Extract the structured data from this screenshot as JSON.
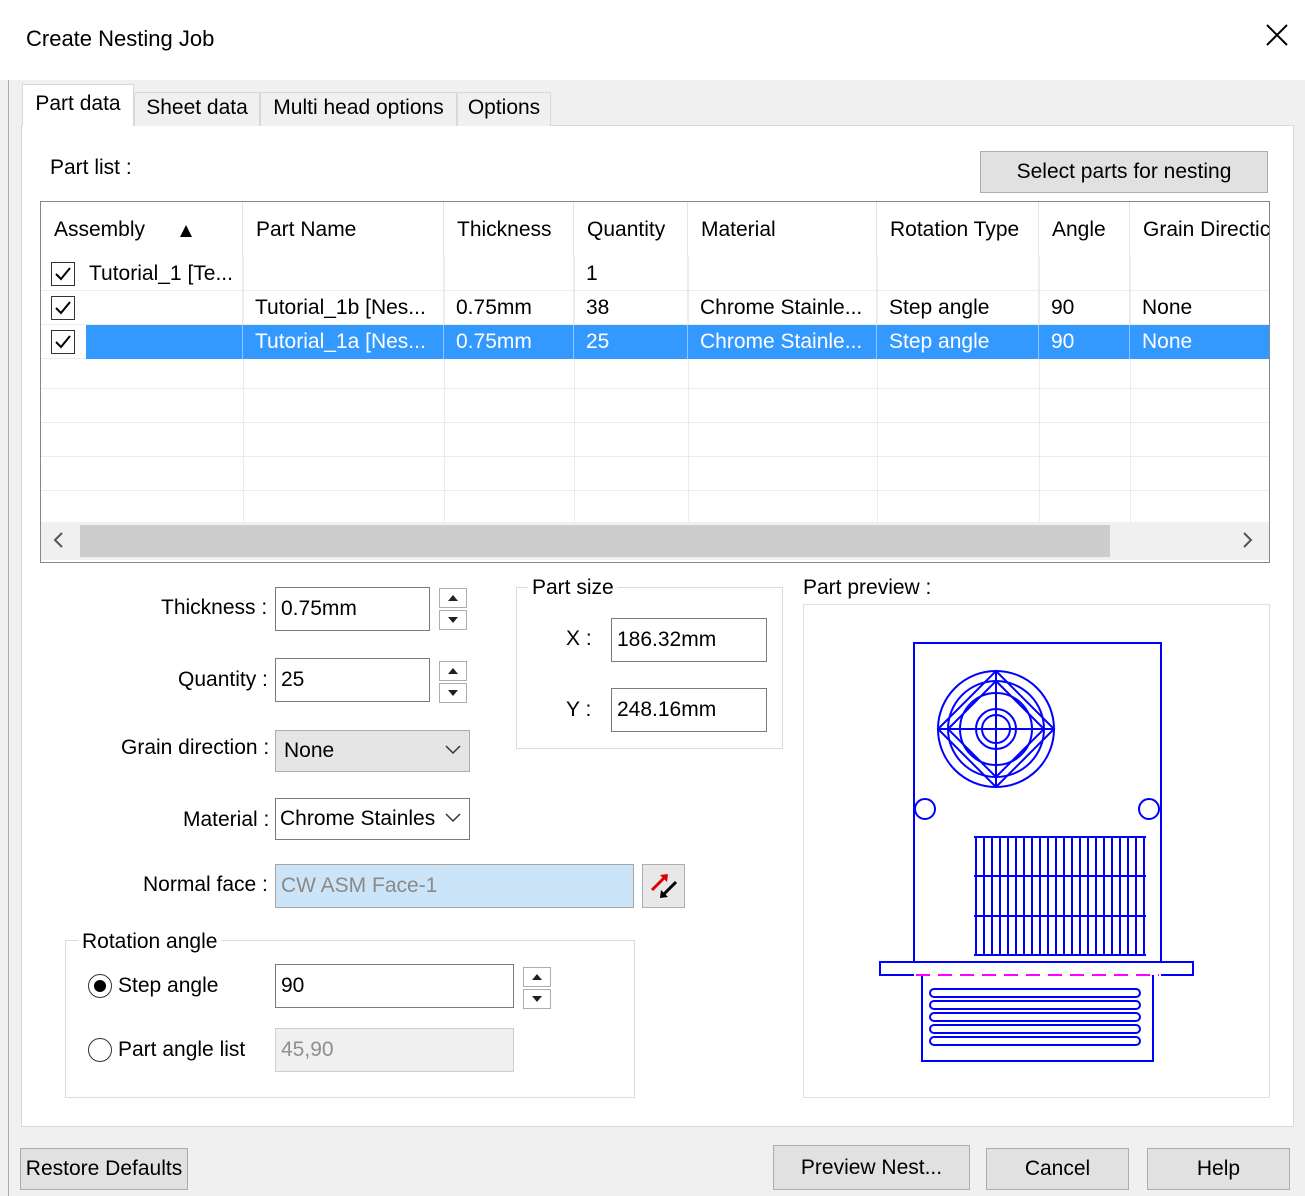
{
  "window": {
    "title": "Create Nesting Job"
  },
  "tabs": [
    "Part data",
    "Sheet data",
    "Multi head options",
    "Options"
  ],
  "part_list": {
    "label": "Part list :",
    "select_button": "Select parts for nesting",
    "columns": [
      "Assembly",
      "Part Name",
      "Thickness",
      "Quantity",
      "Material",
      "Rotation Type",
      "Angle",
      "Grain Directic"
    ],
    "rows": [
      {
        "checked": true,
        "assembly": "Tutorial_1 [Te...",
        "part_name": "",
        "thickness": "",
        "quantity": "1",
        "material": "",
        "rotation_type": "",
        "angle": "",
        "grain": ""
      },
      {
        "checked": true,
        "assembly": "",
        "part_name": "Tutorial_1b [Nes...",
        "thickness": "0.75mm",
        "quantity": "38",
        "material": "Chrome Stainle...",
        "rotation_type": "Step angle",
        "angle": "90",
        "grain": "None"
      },
      {
        "checked": true,
        "selected": true,
        "assembly": "",
        "part_name": "Tutorial_1a [Nes...",
        "thickness": "0.75mm",
        "quantity": "25",
        "material": "Chrome Stainle...",
        "rotation_type": "Step angle",
        "angle": "90",
        "grain": "None"
      }
    ]
  },
  "fields": {
    "thickness_label": "Thickness :",
    "thickness_value": "0.75mm",
    "quantity_label": "Quantity :",
    "quantity_value": "25",
    "grain_label": "Grain direction :",
    "grain_value": "None",
    "material_label": "Material :",
    "material_value": "Chrome Stainles",
    "normal_face_label": "Normal face :",
    "normal_face_value": "CW ASM Face-1"
  },
  "part_size": {
    "title": "Part size",
    "x_label": "X :",
    "x_value": "186.32mm",
    "y_label": "Y :",
    "y_value": "248.16mm"
  },
  "rotation": {
    "title": "Rotation angle",
    "step_label": "Step angle",
    "step_value": "90",
    "list_label": "Part angle list",
    "list_value": "45,90",
    "selected": "step"
  },
  "preview": {
    "label": "Part preview :",
    "color": "#0000ff",
    "bend_color": "#ff00ff"
  },
  "buttons": {
    "restore": "Restore Defaults",
    "preview_nest": "Preview Nest...",
    "cancel": "Cancel",
    "help": "Help"
  }
}
